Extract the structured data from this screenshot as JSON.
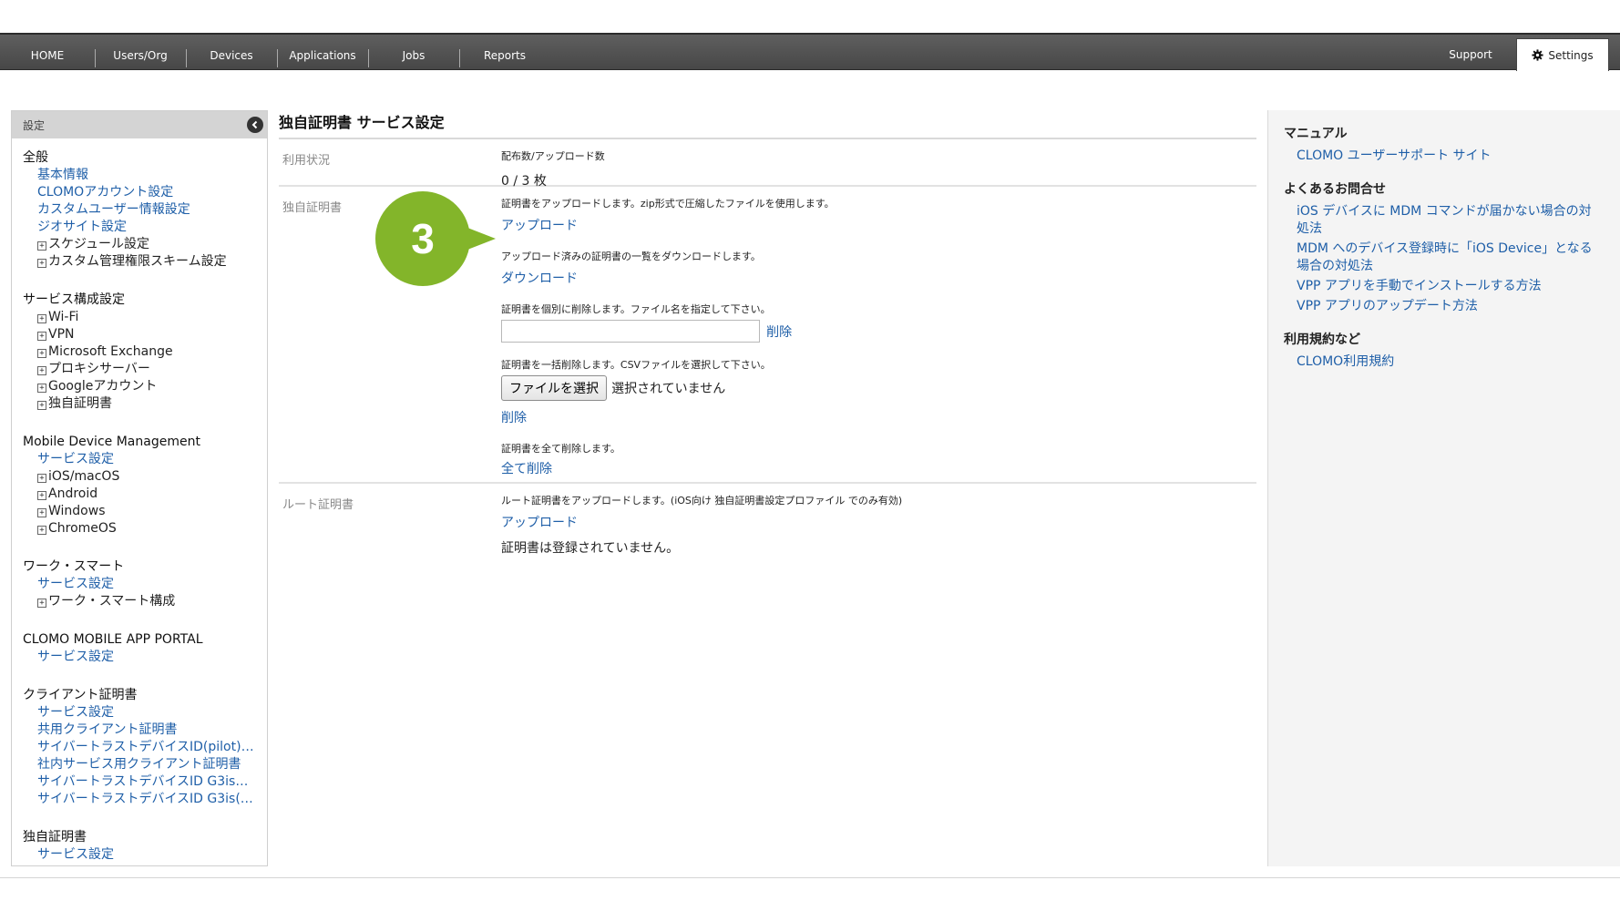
{
  "nav": {
    "items": [
      "HOME",
      "Users/Org",
      "Devices",
      "Applications",
      "Jobs",
      "Reports"
    ],
    "support": "Support",
    "settings": "Settings"
  },
  "sidebar": {
    "header": "設定",
    "groups": [
      {
        "title": "全般",
        "items": [
          {
            "label": "基本情報",
            "kind": "link"
          },
          {
            "label": "CLOMOアカウント設定",
            "kind": "link"
          },
          {
            "label": "カスタムユーザー情報設定",
            "kind": "link"
          },
          {
            "label": "ジオサイト設定",
            "kind": "link"
          },
          {
            "label": "スケジュール設定",
            "kind": "tree"
          },
          {
            "label": "カスタム管理権限スキーム設定",
            "kind": "tree"
          }
        ]
      },
      {
        "title": "サービス構成設定",
        "items": [
          {
            "label": "Wi-Fi",
            "kind": "tree"
          },
          {
            "label": "VPN",
            "kind": "tree"
          },
          {
            "label": "Microsoft Exchange",
            "kind": "tree"
          },
          {
            "label": "プロキシサーバー",
            "kind": "tree"
          },
          {
            "label": "Googleアカウント",
            "kind": "tree"
          },
          {
            "label": "独自証明書",
            "kind": "tree"
          }
        ]
      },
      {
        "title": "Mobile Device Management",
        "items": [
          {
            "label": "サービス設定",
            "kind": "link"
          },
          {
            "label": "iOS/macOS",
            "kind": "tree"
          },
          {
            "label": "Android",
            "kind": "tree"
          },
          {
            "label": "Windows",
            "kind": "tree"
          },
          {
            "label": "ChromeOS",
            "kind": "tree"
          }
        ]
      },
      {
        "title": "ワーク・スマート",
        "items": [
          {
            "label": "サービス設定",
            "kind": "link"
          },
          {
            "label": "ワーク・スマート構成",
            "kind": "tree"
          }
        ]
      },
      {
        "title": "CLOMO MOBILE APP PORTAL",
        "items": [
          {
            "label": "サービス設定",
            "kind": "link"
          }
        ]
      },
      {
        "title": "クライアント証明書",
        "items": [
          {
            "label": "サービス設定",
            "kind": "link"
          },
          {
            "label": "共用クライアント証明書",
            "kind": "link"
          },
          {
            "label": "サイバートラストデバイスID(pilot)…",
            "kind": "link"
          },
          {
            "label": "社内サービス用クライアント証明書",
            "kind": "link"
          },
          {
            "label": "サイバートラストデバイスID G3is…",
            "kind": "link"
          },
          {
            "label": "サイバートラストデバイスID G3is(…",
            "kind": "link"
          }
        ]
      },
      {
        "title": "独自証明書",
        "items": [
          {
            "label": "サービス設定",
            "kind": "link"
          }
        ]
      }
    ]
  },
  "main": {
    "title": "独自証明書 サービス設定",
    "usage": {
      "label": "利用状況",
      "caption": "配布数/アップロード数",
      "value": "0 / 3 枚"
    },
    "custom_cert": {
      "label": "独自証明書",
      "upload_desc": "証明書をアップロードします。zip形式で圧縮したファイルを使用します。",
      "upload_link": "アップロード",
      "download_desc": "アップロード済みの証明書の一覧をダウンロードします。",
      "download_link": "ダウンロード",
      "delete_one_desc": "証明書を個別に削除します。ファイル名を指定して下さい。",
      "delete_one_link": "削除",
      "bulk_desc": "証明書を一括削除します。CSVファイルを選択して下さい。",
      "choose_file": "ファイルを選択",
      "no_file": "選択されていません",
      "bulk_delete_link": "削除",
      "delete_all_desc": "証明書を全て削除します。",
      "delete_all_link": "全て削除"
    },
    "root_cert": {
      "label": "ルート証明書",
      "desc": "ルート証明書をアップロードします。(iOS向け 独自証明書設定プロファイル でのみ有効)",
      "upload_link": "アップロード",
      "status": "証明書は登録されていません。"
    },
    "step_badge": "3"
  },
  "right": {
    "groups": [
      {
        "heading": "マニュアル",
        "links": [
          "CLOMO ユーザーサポート サイト"
        ]
      },
      {
        "heading": "よくあるお問合せ",
        "links": [
          "iOS デバイスに MDM コマンドが届かない場合の対処法",
          "MDM へのデバイス登録時に「iOS Device」となる場合の対処法",
          "VPP アプリを手動でインストールする方法",
          "VPP アプリのアップデート方法"
        ]
      },
      {
        "heading": "利用規約など",
        "links": [
          "CLOMO利用規約"
        ]
      }
    ]
  },
  "colors": {
    "accent_green": "#83b52a",
    "link_blue": "#1f5fa8",
    "nav_bg": "#4f4f4f"
  }
}
